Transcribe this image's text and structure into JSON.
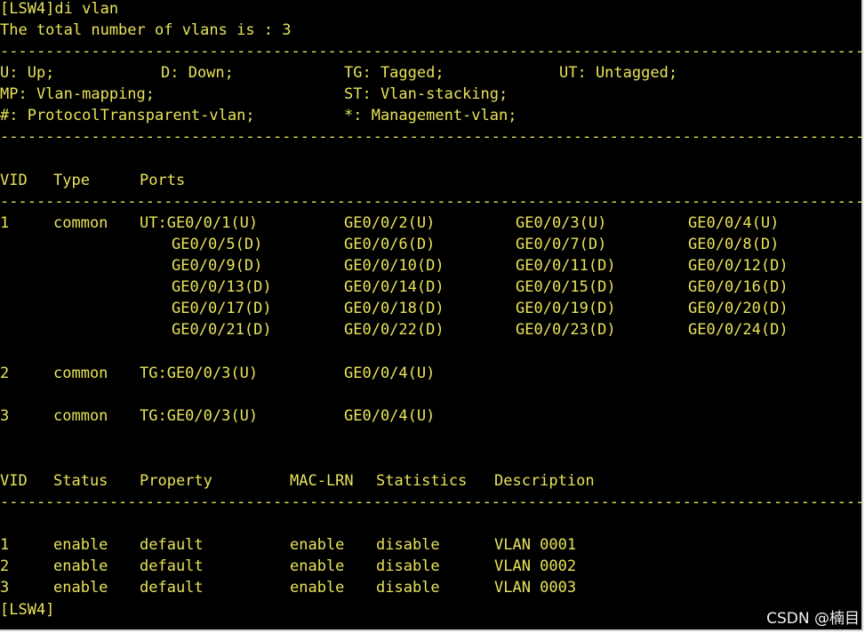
{
  "terminal": {
    "prompt_cmd": "[LSW4]di vlan",
    "total_line": "The total number of vlans is : 3",
    "separator": "----------------------------------------------------------------------------------------------------------------------------",
    "legend": {
      "u": "U: Up;",
      "d": "D: Down;",
      "tg": "TG: Tagged;",
      "ut": "UT: Untagged;",
      "mp": "MP: Vlan-mapping;",
      "st": "ST: Vlan-stacking;",
      "hash": "#: ProtocolTransparent-vlan;",
      "star": "*: Management-vlan;"
    },
    "port_table": {
      "headers": [
        "VID",
        "Type",
        "Ports"
      ],
      "vlan1": {
        "vid": "1",
        "type": "common",
        "lines": [
          [
            "UT:GE0/0/1(U)",
            "GE0/0/2(U)",
            "GE0/0/3(U)",
            "GE0/0/4(U)"
          ],
          [
            "GE0/0/5(D)",
            "GE0/0/6(D)",
            "GE0/0/7(D)",
            "GE0/0/8(D)"
          ],
          [
            "GE0/0/9(D)",
            "GE0/0/10(D)",
            "GE0/0/11(D)",
            "GE0/0/12(D)"
          ],
          [
            "GE0/0/13(D)",
            "GE0/0/14(D)",
            "GE0/0/15(D)",
            "GE0/0/16(D)"
          ],
          [
            "GE0/0/17(D)",
            "GE0/0/18(D)",
            "GE0/0/19(D)",
            "GE0/0/20(D)"
          ],
          [
            "GE0/0/21(D)",
            "GE0/0/22(D)",
            "GE0/0/23(D)",
            "GE0/0/24(D)"
          ]
        ]
      },
      "vlan2": {
        "vid": "2",
        "type": "common",
        "ports": [
          "TG:GE0/0/3(U)",
          "GE0/0/4(U)"
        ]
      },
      "vlan3": {
        "vid": "3",
        "type": "common",
        "ports": [
          "TG:GE0/0/3(U)",
          "GE0/0/4(U)"
        ]
      }
    },
    "status_table": {
      "headers": [
        "VID",
        "Status",
        "Property",
        "MAC-LRN",
        "Statistics",
        "Description"
      ],
      "rows": [
        [
          "1",
          "enable",
          "default",
          "enable",
          "disable",
          "VLAN 0001"
        ],
        [
          "2",
          "enable",
          "default",
          "enable",
          "disable",
          "VLAN 0002"
        ],
        [
          "3",
          "enable",
          "default",
          "enable",
          "disable",
          "VLAN 0003"
        ]
      ]
    },
    "end_prompt": "[LSW4]",
    "text_color": "#e8e35a",
    "background_color": "#000000"
  },
  "watermark": "CSDN @楠目"
}
